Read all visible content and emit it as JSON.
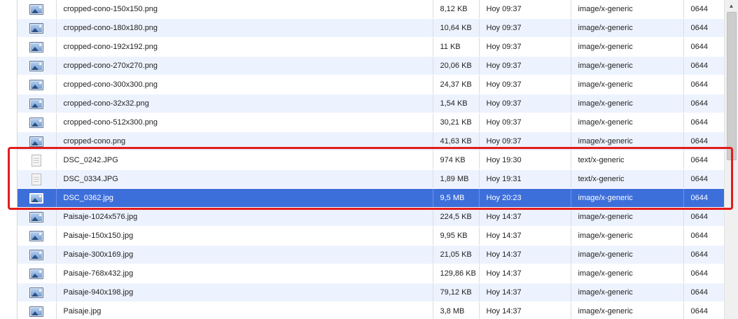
{
  "files": [
    {
      "name": "cropped-cono-150x150.png",
      "size": "8,12 KB",
      "modified": "Hoy 09:37",
      "mime": "image/x-generic",
      "perms": "0644",
      "icon": "image-file-icon",
      "selected": false
    },
    {
      "name": "cropped-cono-180x180.png",
      "size": "10,64 KB",
      "modified": "Hoy 09:37",
      "mime": "image/x-generic",
      "perms": "0644",
      "icon": "image-file-icon",
      "selected": false
    },
    {
      "name": "cropped-cono-192x192.png",
      "size": "11 KB",
      "modified": "Hoy 09:37",
      "mime": "image/x-generic",
      "perms": "0644",
      "icon": "image-file-icon",
      "selected": false
    },
    {
      "name": "cropped-cono-270x270.png",
      "size": "20,06 KB",
      "modified": "Hoy 09:37",
      "mime": "image/x-generic",
      "perms": "0644",
      "icon": "image-file-icon",
      "selected": false
    },
    {
      "name": "cropped-cono-300x300.png",
      "size": "24,37 KB",
      "modified": "Hoy 09:37",
      "mime": "image/x-generic",
      "perms": "0644",
      "icon": "image-file-icon",
      "selected": false
    },
    {
      "name": "cropped-cono-32x32.png",
      "size": "1,54 KB",
      "modified": "Hoy 09:37",
      "mime": "image/x-generic",
      "perms": "0644",
      "icon": "image-file-icon",
      "selected": false
    },
    {
      "name": "cropped-cono-512x300.png",
      "size": "30,21 KB",
      "modified": "Hoy 09:37",
      "mime": "image/x-generic",
      "perms": "0644",
      "icon": "image-file-icon",
      "selected": false
    },
    {
      "name": "cropped-cono.png",
      "size": "41,63 KB",
      "modified": "Hoy 09:37",
      "mime": "image/x-generic",
      "perms": "0644",
      "icon": "image-file-icon",
      "selected": false
    },
    {
      "name": "DSC_0242.JPG",
      "size": "974 KB",
      "modified": "Hoy 19:30",
      "mime": "text/x-generic",
      "perms": "0644",
      "icon": "text-file-icon",
      "selected": false
    },
    {
      "name": "DSC_0334.JPG",
      "size": "1,89 MB",
      "modified": "Hoy 19:31",
      "mime": "text/x-generic",
      "perms": "0644",
      "icon": "text-file-icon",
      "selected": false
    },
    {
      "name": "DSC_0362.jpg",
      "size": "9,5 MB",
      "modified": "Hoy 20:23",
      "mime": "image/x-generic",
      "perms": "0644",
      "icon": "image-file-icon",
      "selected": true
    },
    {
      "name": "Paisaje-1024x576.jpg",
      "size": "224,5 KB",
      "modified": "Hoy 14:37",
      "mime": "image/x-generic",
      "perms": "0644",
      "icon": "image-file-icon",
      "selected": false
    },
    {
      "name": "Paisaje-150x150.jpg",
      "size": "9,95 KB",
      "modified": "Hoy 14:37",
      "mime": "image/x-generic",
      "perms": "0644",
      "icon": "image-file-icon",
      "selected": false
    },
    {
      "name": "Paisaje-300x169.jpg",
      "size": "21,05 KB",
      "modified": "Hoy 14:37",
      "mime": "image/x-generic",
      "perms": "0644",
      "icon": "image-file-icon",
      "selected": false
    },
    {
      "name": "Paisaje-768x432.jpg",
      "size": "129,86 KB",
      "modified": "Hoy 14:37",
      "mime": "image/x-generic",
      "perms": "0644",
      "icon": "image-file-icon",
      "selected": false
    },
    {
      "name": "Paisaje-940x198.jpg",
      "size": "79,12 KB",
      "modified": "Hoy 14:37",
      "mime": "image/x-generic",
      "perms": "0644",
      "icon": "image-file-icon",
      "selected": false
    },
    {
      "name": "Paisaje.jpg",
      "size": "3,8 MB",
      "modified": "Hoy 14:37",
      "mime": "image/x-generic",
      "perms": "0644",
      "icon": "image-file-icon",
      "selected": false
    }
  ],
  "colors": {
    "row_alt": "#edf3fe",
    "row_selected": "#3d6fdb",
    "annotation": "#e31c1c"
  },
  "scrollbar": {
    "up_arrow_icon": "chevron-up-icon"
  }
}
